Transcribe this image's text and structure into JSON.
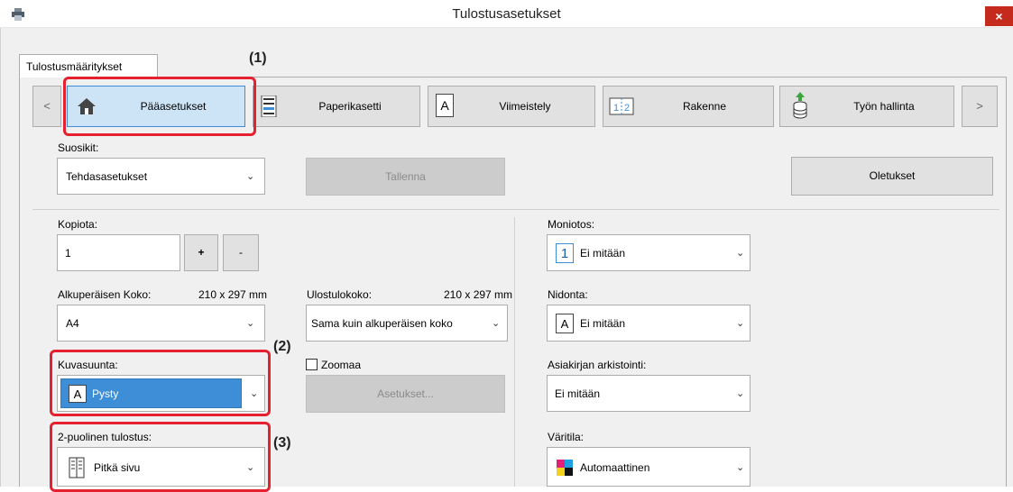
{
  "window": {
    "title": "Tulostusasetukset",
    "close_label": "×"
  },
  "tab_label": "Tulostusmääritykset",
  "nav": {
    "prev_label": "<",
    "next_label": ">",
    "tabs": [
      {
        "label": "Pääasetukset",
        "icon": "home-icon"
      },
      {
        "label": "Paperikasetti",
        "icon": "paper-tray-icon"
      },
      {
        "label": "Viimeistely",
        "icon": "finishing-icon"
      },
      {
        "label": "Rakenne",
        "icon": "layout-icon"
      },
      {
        "label": "Työn hallinta",
        "icon": "job-handling-icon"
      }
    ]
  },
  "favorites": {
    "label": "Suosikit:",
    "value": "Tehdasasetukset",
    "save_label": "Tallenna",
    "defaults_label": "Oletukset"
  },
  "copies": {
    "label": "Kopiota:",
    "value": "1",
    "plus_label": "+",
    "minus_label": "-"
  },
  "original_size": {
    "label": "Alkuperäisen Koko:",
    "dims": "210 x 297 mm",
    "value": "A4"
  },
  "output_size": {
    "label": "Ulostulokoko:",
    "dims": "210 x 297 mm",
    "value": "Sama kuin alkuperäisen koko"
  },
  "orientation": {
    "label": "Kuvasuunta:",
    "value": "Pysty",
    "icon_letter": "A"
  },
  "zoom": {
    "label": "Zoomaa",
    "checked": false,
    "settings_label": "Asetukset..."
  },
  "duplex": {
    "label": "2-puolinen tulostus:",
    "value": "Pitkä sivu"
  },
  "n_up": {
    "label": "Moniotos:",
    "value": "Ei mitään",
    "icon_letter": "1"
  },
  "binding": {
    "label": "Nidonta:",
    "value": "Ei mitään",
    "icon_letter": "A"
  },
  "archiving": {
    "label": "Asiakirjan arkistointi:",
    "value": "Ei mitään"
  },
  "color_mode": {
    "label": "Väritila:",
    "value": "Automaattinen"
  },
  "callouts": {
    "c1": "(1)",
    "c2": "(2)",
    "c3": "(3)"
  },
  "colors": {
    "highlight_red": "#e5202f",
    "selection_blue": "#3d8ed7",
    "close_red": "#c42b1c"
  }
}
